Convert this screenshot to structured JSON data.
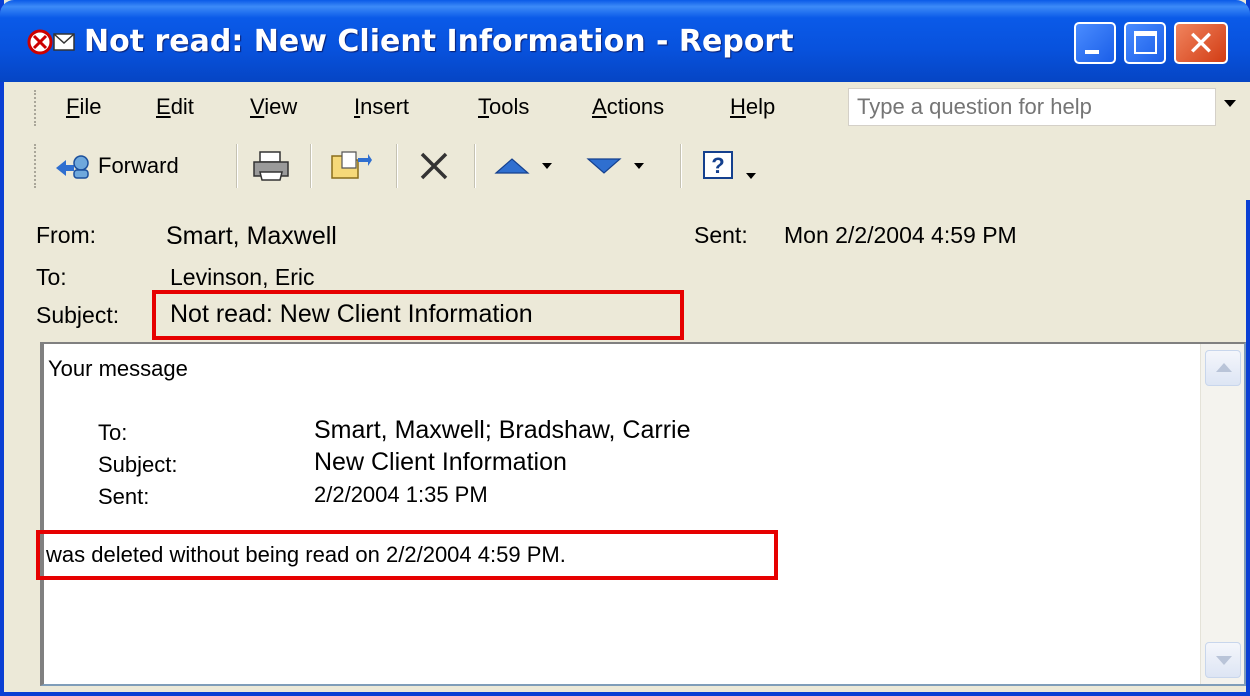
{
  "window": {
    "title": "Not read: New Client Information - Report",
    "title_icon": "read-report-envelope-icon",
    "buttons": [
      "minimize",
      "maximize",
      "close"
    ]
  },
  "menu": {
    "items": [
      "File",
      "Edit",
      "View",
      "Insert",
      "Tools",
      "Actions",
      "Help"
    ],
    "help_placeholder": "Type a question for help"
  },
  "toolbar": {
    "forward_label": "Forward",
    "icons": [
      "forward-icon",
      "print-icon",
      "move-to-folder-icon",
      "delete-icon",
      "previous-item-icon",
      "next-item-icon",
      "help-icon"
    ]
  },
  "header": {
    "from_label": "From:",
    "from_value": "Smart, Maxwell",
    "sent_label": "Sent:",
    "sent_value": "Mon 2/2/2004 4:59 PM",
    "to_label": "To:",
    "to_value": "Levinson, Eric",
    "subject_label": "Subject:",
    "subject_value": "Not read: New Client Information"
  },
  "body": {
    "intro": "Your message",
    "to_label": "To:",
    "to_value": "Smart, Maxwell; Bradshaw, Carrie",
    "subject_label": "Subject:",
    "subject_value": "New Client Information",
    "sent_label": "Sent:",
    "sent_value": "2/2/2004 1:35 PM",
    "status_line": "was deleted without being read on 2/2/2004 4:59 PM."
  },
  "colors": {
    "titlebar": "#0a5ae8",
    "highlight_box": "#e60000",
    "window_bg": "#ece9d8"
  }
}
